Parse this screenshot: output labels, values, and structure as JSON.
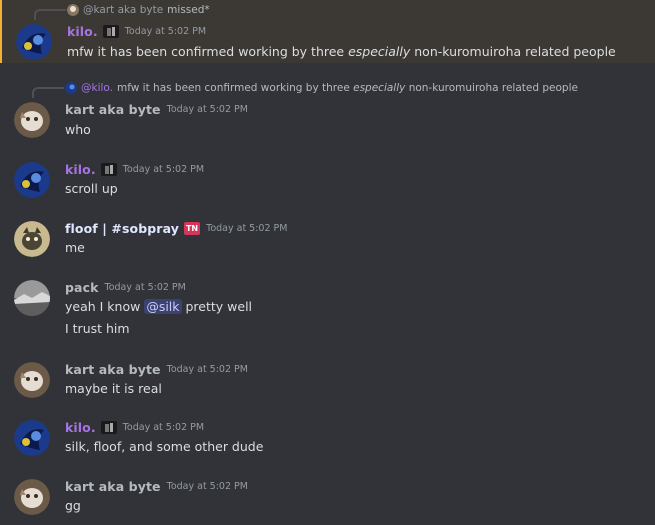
{
  "colors": {
    "background": "#313338",
    "highlight_bar": "#f0b232",
    "kilo": "#a673e5",
    "mention_bg": "#3c4270"
  },
  "messages": [
    {
      "reply_author": "@kart aka byte",
      "reply_text": "missed*",
      "author": "kilo.",
      "time": "Today at 5:02 PM",
      "text_pre": "mfw it has been confirmed working by three ",
      "text_em": "especially",
      "text_post": " non-kuromuiroha related people"
    },
    {
      "reply_author": "@kilo.",
      "reply_pre": "mfw it has been confirmed working by three ",
      "reply_em": "especially",
      "reply_post": " non-kuromuiroha related people",
      "author": "kart aka byte",
      "time": "Today at 5:02 PM",
      "text": "who"
    },
    {
      "author": "kilo.",
      "time": "Today at 5:02 PM",
      "text": "scroll up"
    },
    {
      "author": "floof | #sobpray",
      "badge": "TN",
      "time": "Today at 5:02 PM",
      "text": "me"
    },
    {
      "author": "pack",
      "time": "Today at 5:02 PM",
      "text_pre": "yeah I know ",
      "mention": "@silk",
      "text_post": " pretty well",
      "text2": "I trust him"
    },
    {
      "author": "kart aka byte",
      "time": "Today at 5:02 PM",
      "text": "maybe it is real"
    },
    {
      "author": "kilo.",
      "time": "Today at 5:02 PM",
      "text": "silk, floof, and some other dude"
    },
    {
      "author": "kart aka byte",
      "time": "Today at 5:02 PM",
      "text": "gg"
    }
  ]
}
